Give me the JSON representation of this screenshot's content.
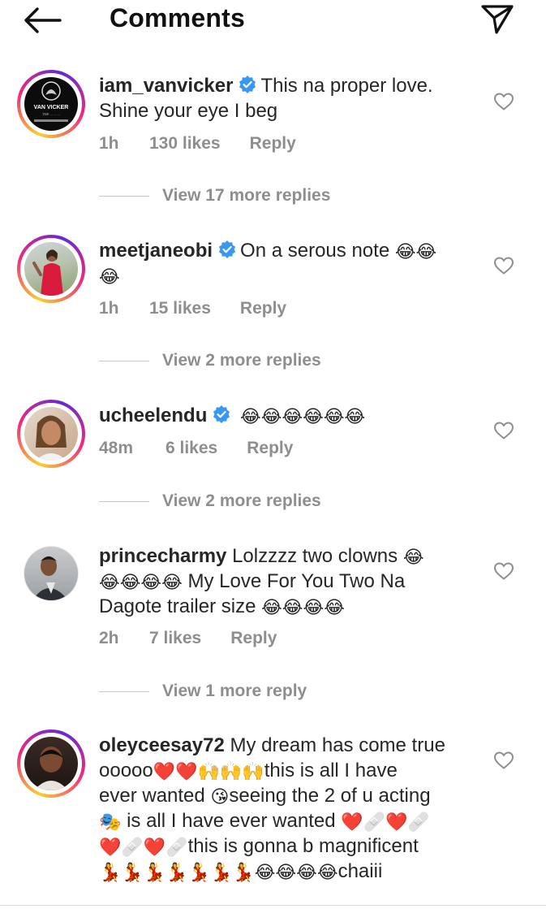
{
  "header": {
    "title": "Comments"
  },
  "comments": [
    {
      "username": "iam_vanvicker",
      "verified": true,
      "text_1": "This na proper love.",
      "text_2": "Shine your eye I beg",
      "time": "1h",
      "likes": "130 likes",
      "reply": "Reply",
      "view_replies": "View 17 more replies",
      "avatar_text_1": "VAN VICKER",
      "avatar_text_2": "THE ... ... ..."
    },
    {
      "username": "meetjaneobi",
      "verified": true,
      "text": "On a serous note",
      "emoji_line_1": "😂😂",
      "emoji_line_2": "😂",
      "time": "1h",
      "likes": "15 likes",
      "reply": "Reply",
      "view_replies": "View 2 more replies"
    },
    {
      "username": "ucheelendu",
      "verified": true,
      "emoji": "😂😂😂😂😂😂",
      "time": "48m",
      "likes": "6 likes",
      "reply": "Reply",
      "view_replies": "View 2 more replies"
    },
    {
      "username": "princecharmy",
      "verified": false,
      "t1": "Lolzzzz two clowns",
      "e1": "😂",
      "e2": "😂😂😂😂",
      "t2": "My Love For You Two Na",
      "t3": "Dagote trailer size",
      "e3": "😂😂😂😂",
      "time": "2h",
      "likes": "7 likes",
      "reply": "Reply",
      "view_replies": "View 1 more reply"
    },
    {
      "username": "oleyceesay72",
      "verified": false,
      "t1": "My dream has come true",
      "t2": "ooooo",
      "e2": "❤️❤️🙌🙌🙌",
      "t2b": "this is all I have",
      "t3": "ever wanted",
      "e3": "😘",
      "t3b": "seeing the 2 of u acting",
      "e4": "🎭",
      "t4": "is all I have ever wanted",
      "e4b": "❤️🩹❤️🩹",
      "e5": "❤️🩹❤️🩹",
      "t5": "this is gonna b magnificent",
      "e6": "💃💃💃💃💃💃💃😂😂😂😂",
      "t6": "chaiii"
    }
  ],
  "colors": {
    "verified": "#3897f0",
    "meta": "#8e8e8e",
    "text": "#262626"
  }
}
